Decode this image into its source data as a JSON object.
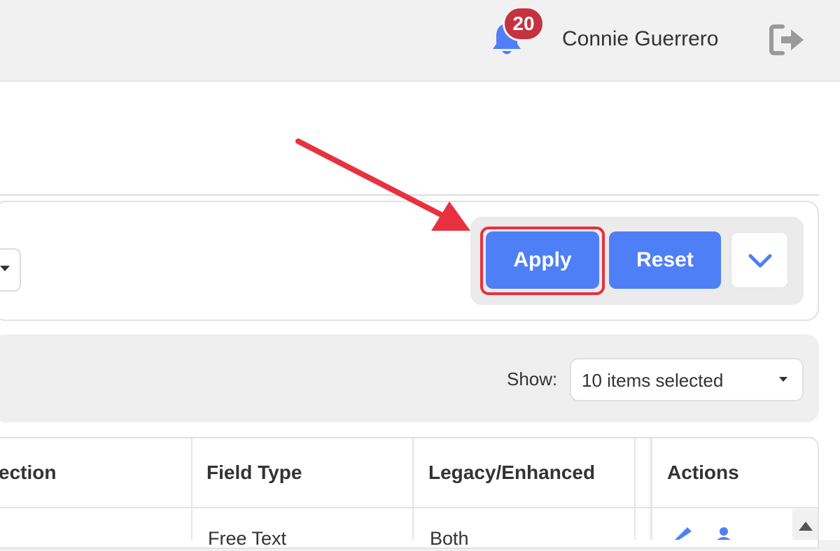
{
  "header": {
    "notification_count": "20",
    "user_name": "Connie Guerrero",
    "icons": {
      "notifications": "bell-icon",
      "logout": "sign-out-icon"
    }
  },
  "filters": {
    "apply_label": "Apply",
    "reset_label": "Reset",
    "expand_icon": "chevron-down-icon"
  },
  "list_controls": {
    "show_label": "Show:",
    "show_value": "10 items selected"
  },
  "table": {
    "columns": [
      "ection",
      "Field Type",
      "Legacy/Enhanced",
      "Actions"
    ],
    "rows": [
      {
        "field_type": "Free Text",
        "legacy_enhanced": "Both"
      }
    ],
    "row_action_icons": [
      "edit-pencil-icon",
      "user-icon"
    ]
  },
  "colors": {
    "primary": "#4f7ff7",
    "badge": "#c6323f",
    "annotation": "#e8313f"
  }
}
